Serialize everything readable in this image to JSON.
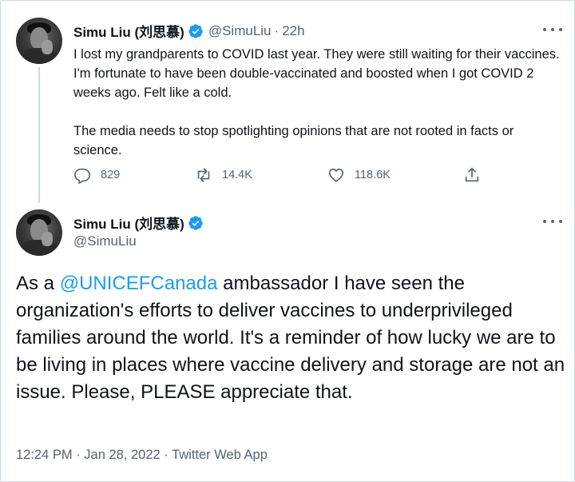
{
  "tweet1": {
    "display_name": "Simu Liu (刘思慕)",
    "handle": "@SimuLiu",
    "separator": "·",
    "time": "22h",
    "paragraph1": "I lost my grandparents to COVID last year. They were still waiting for their vaccines. I'm fortunate to have been double-vaccinated and boosted when I got COVID 2 weeks ago. Felt like a cold.",
    "paragraph2": "The media needs to stop spotlighting opinions that are not rooted in facts or science.",
    "replies": "829",
    "retweets": "14.4K",
    "likes": "118.6K",
    "icons": [
      "reply-icon",
      "retweet-icon",
      "like-icon",
      "share-icon"
    ]
  },
  "tweet2": {
    "display_name": "Simu Liu (刘思慕)",
    "handle": "@SimuLiu",
    "text_prefix": "As a ",
    "mention": "@UNICEFCanada",
    "text_rest": " ambassador I have seen the organization's efforts to deliver vaccines to underprivileged families around the world. It's a reminder of how lucky we are to be living in places where vaccine delivery and storage are not an issue. Please, PLEASE appreciate that.",
    "timestamp": "12:24 PM · Jan 28, 2022 · Twitter Web App"
  },
  "colors": {
    "accent": "#1d9bf0",
    "text": "#0f1419",
    "muted": "#536471",
    "border": "#cfd9de"
  }
}
